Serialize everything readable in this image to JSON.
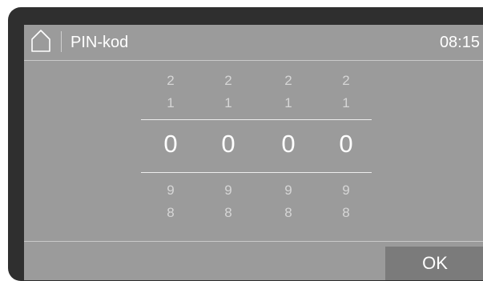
{
  "header": {
    "title": "PIN-kod",
    "time": "08:15"
  },
  "pin_wheels": [
    {
      "above2": "2",
      "above1": "1",
      "value": "0",
      "below1": "9",
      "below2": "8"
    },
    {
      "above2": "2",
      "above1": "1",
      "value": "0",
      "below1": "9",
      "below2": "8"
    },
    {
      "above2": "2",
      "above1": "1",
      "value": "0",
      "below1": "9",
      "below2": "8"
    },
    {
      "above2": "2",
      "above1": "1",
      "value": "0",
      "below1": "9",
      "below2": "8"
    }
  ],
  "footer": {
    "ok_label": "OK"
  },
  "colors": {
    "screen_bg": "#9b9b9b",
    "ok_button_bg": "#7b7b7b",
    "text": "#ffffff"
  },
  "icons": {
    "home": "home-icon"
  }
}
